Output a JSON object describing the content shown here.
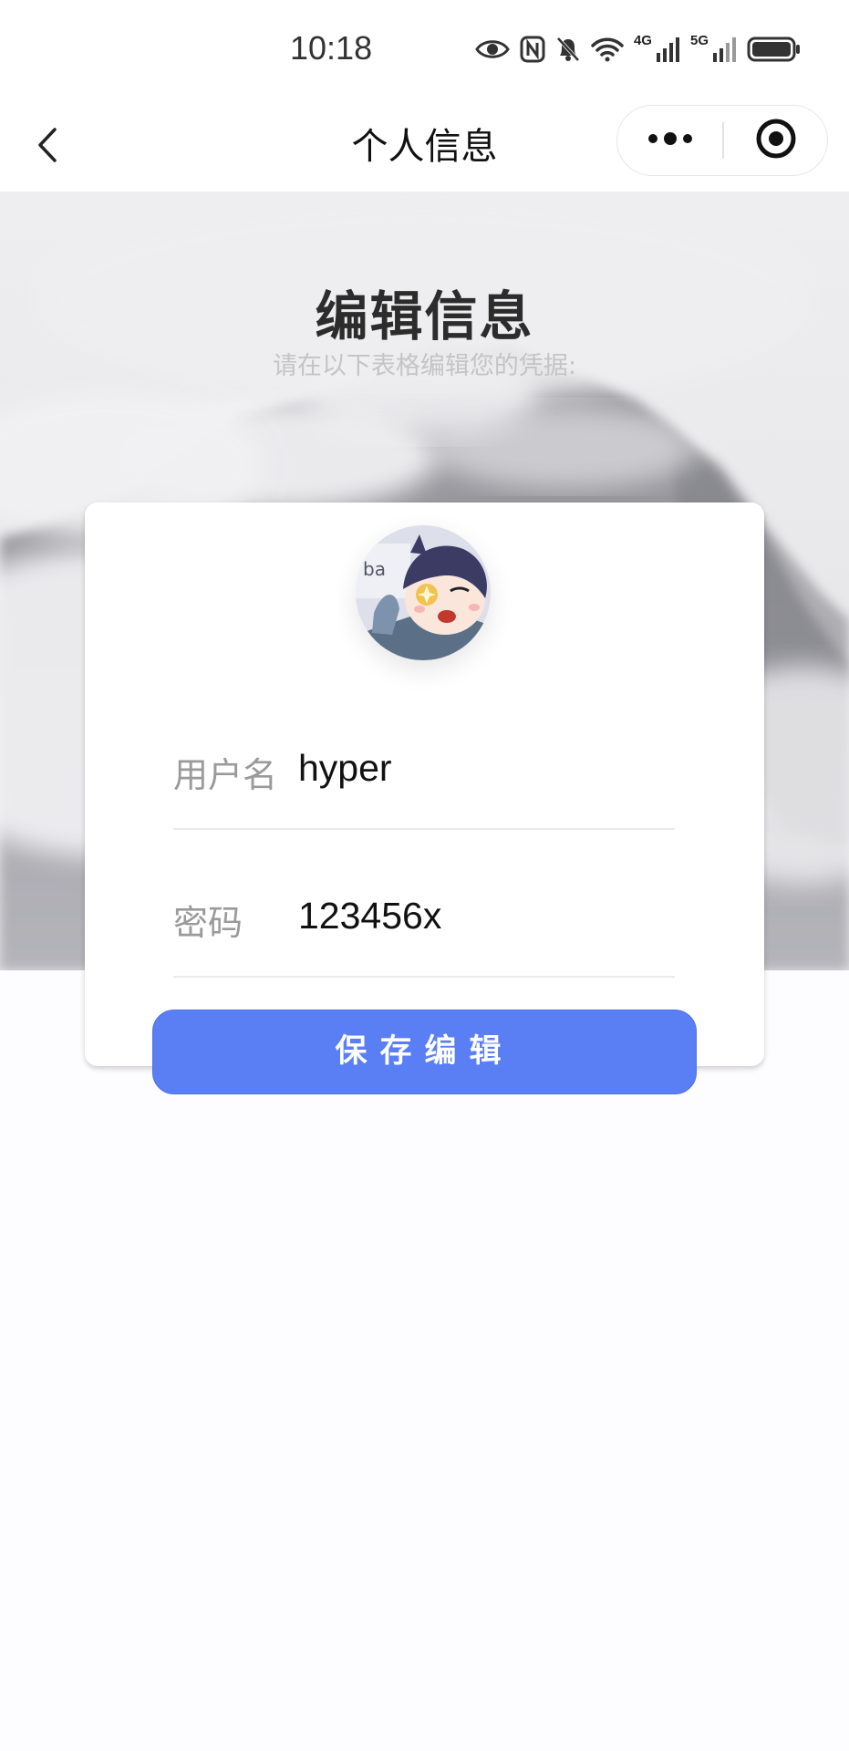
{
  "status_bar": {
    "time": "10:18",
    "icons": [
      "eye-icon",
      "nfc-icon",
      "bell-off-icon",
      "wifi-icon",
      "signal-4g-icon",
      "signal-5g-icon",
      "battery-icon"
    ],
    "net_label_1": "4G",
    "net_label_2": "5G"
  },
  "nav": {
    "title": "个人信息",
    "back_icon": "chevron-left-icon",
    "more_icon": "more-dots-icon",
    "close_icon": "target-circle-icon"
  },
  "hero": {
    "title": "编辑信息",
    "subtitle": "请在以下表格编辑您的凭据:"
  },
  "form": {
    "avatar_alt": "avatar",
    "username": {
      "label": "用户名",
      "value": "hyper"
    },
    "password": {
      "label": "密码",
      "value": "123456x"
    },
    "save_label": "保存编辑"
  },
  "colors": {
    "accent": "#5a7ff5",
    "label_gray": "#9a9a9a",
    "subtitle_gray": "#c4c4c4",
    "background": "#fdfcfe"
  }
}
